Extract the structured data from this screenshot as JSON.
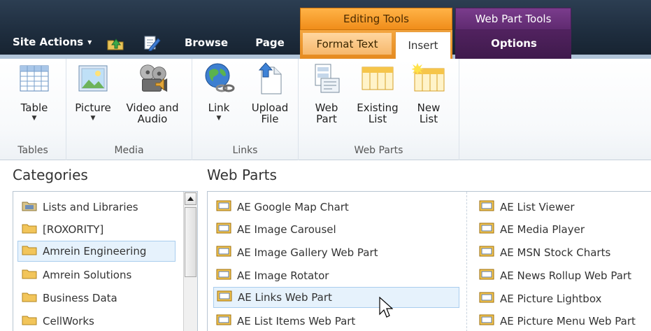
{
  "ribbon_tabs": {
    "site_actions": "Site Actions",
    "site_actions_caret": "▾",
    "browse": "Browse",
    "page": "Page",
    "editing_tools": "Editing Tools",
    "format_text": "Format Text",
    "insert": "Insert",
    "web_part_tools": "Web Part Tools",
    "options": "Options"
  },
  "groups": {
    "tables": {
      "label": "Tables",
      "buttons": [
        {
          "label": "Table",
          "icon": "table-icon",
          "dropdown": true
        }
      ]
    },
    "media": {
      "label": "Media",
      "buttons": [
        {
          "label": "Picture",
          "icon": "picture-icon",
          "dropdown": true
        },
        {
          "label": "Video and\nAudio",
          "icon": "video-audio-icon",
          "dropdown": false
        }
      ]
    },
    "links": {
      "label": "Links",
      "buttons": [
        {
          "label": "Link",
          "icon": "link-globe-icon",
          "dropdown": true
        },
        {
          "label": "Upload\nFile",
          "icon": "upload-file-icon",
          "dropdown": false
        }
      ]
    },
    "web_parts": {
      "label": "Web Parts",
      "buttons": [
        {
          "label": "Web\nPart",
          "icon": "web-part-icon",
          "dropdown": false
        },
        {
          "label": "Existing\nList",
          "icon": "existing-list-icon",
          "dropdown": false
        },
        {
          "label": "New\nList",
          "icon": "new-list-icon",
          "dropdown": false
        }
      ]
    }
  },
  "categories": {
    "heading": "Categories",
    "items": [
      {
        "label": "Lists and Libraries",
        "icon": "library-folder-icon",
        "selected": false
      },
      {
        "label": "[ROXORITY]",
        "icon": "folder-icon",
        "selected": false
      },
      {
        "label": "Amrein Engineering",
        "icon": "folder-icon",
        "selected": true
      },
      {
        "label": "Amrein Solutions",
        "icon": "folder-icon",
        "selected": false
      },
      {
        "label": "Business Data",
        "icon": "folder-icon",
        "selected": false
      },
      {
        "label": "CellWorks",
        "icon": "folder-icon",
        "selected": false
      }
    ]
  },
  "web_parts": {
    "heading": "Web Parts",
    "column1": [
      {
        "label": "AE Google Map Chart",
        "selected": false
      },
      {
        "label": "AE Image Carousel",
        "selected": false
      },
      {
        "label": "AE Image Gallery Web Part",
        "selected": false
      },
      {
        "label": "AE Image Rotator",
        "selected": false
      },
      {
        "label": "AE Links Web Part",
        "selected": true
      },
      {
        "label": "AE List Items Web Part",
        "selected": false
      }
    ],
    "column2": [
      {
        "label": "AE List Viewer",
        "selected": false
      },
      {
        "label": "AE Media Player",
        "selected": false
      },
      {
        "label": "AE MSN Stock Charts",
        "selected": false
      },
      {
        "label": "AE News Rollup Web Part",
        "selected": false
      },
      {
        "label": "AE Picture Lightbox",
        "selected": false
      },
      {
        "label": "AE Picture Menu Web Part",
        "selected": false
      }
    ]
  },
  "colors": {
    "ribbon_dark": "#1e2d3e",
    "editing_tools_orange": "#f4a640",
    "web_part_tools_purple": "#5f2a70",
    "selection_blue": "#e6f2fc"
  }
}
